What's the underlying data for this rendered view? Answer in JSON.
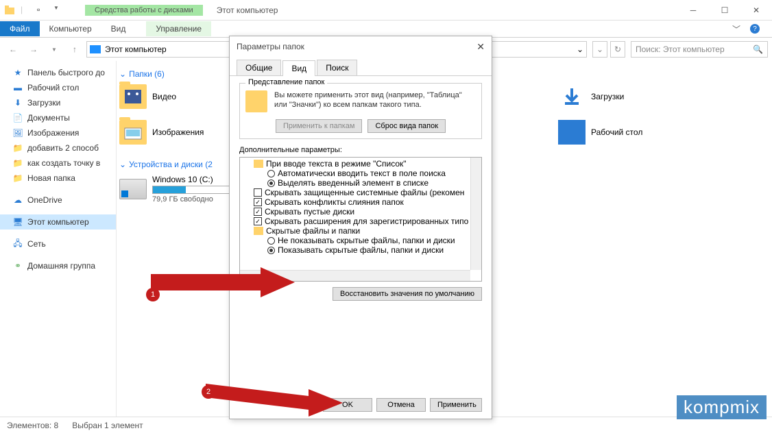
{
  "titlebar": {
    "contextual_tab": "Средства работы с дисками",
    "title": "Этот компьютер"
  },
  "ribbon": {
    "file": "Файл",
    "tabs": [
      "Компьютер",
      "Вид"
    ],
    "ctx_tab": "Управление"
  },
  "nav": {
    "location": "Этот компьютер",
    "search_placeholder": "Поиск: Этот компьютер"
  },
  "sidebar": {
    "quick": "Панель быстрого до",
    "items": [
      "Рабочий стол",
      "Загрузки",
      "Документы",
      "Изображения",
      "добавить 2 способ",
      "как создать точку в",
      "Новая папка"
    ],
    "onedrive": "OneDrive",
    "thispc": "Этот компьютер",
    "network": "Сеть",
    "homegroup": "Домашняя группа"
  },
  "content": {
    "folders_hdr": "Папки (6)",
    "folder_video": "Видео",
    "folder_images": "Изображения",
    "folder_downloads": "Загрузки",
    "folder_desktop": "Рабочий стол",
    "drives_hdr": "Устройства и диски (2",
    "drive_c": "Windows 10 (C:)",
    "drive_c_free": "79,9 ГБ свободно"
  },
  "dialog": {
    "title": "Параметры папок",
    "tabs": [
      "Общие",
      "Вид",
      "Поиск"
    ],
    "group_title": "Представление папок",
    "group_text": "Вы можете применить этот вид (например, \"Таблица\" или \"Значки\") ко всем папкам такого типа.",
    "btn_apply_folders": "Применить к папкам",
    "btn_reset_folders": "Сброс вида папок",
    "adv_label": "Дополнительные параметры:",
    "tree": {
      "n0": "При вводе текста в режиме \"Список\"",
      "n0a": "Автоматически вводить текст в поле поиска",
      "n0b": "Выделять введенный элемент в списке",
      "n1": "Скрывать защищенные системные файлы (рекомен",
      "n2": "Скрывать конфликты слияния папок",
      "n3": "Скрывать пустые диски",
      "n4": "Скрывать расширения для зарегистрированных типо",
      "n5": "Скрытые файлы и папки",
      "n5a": "Не показывать скрытые файлы, папки и диски",
      "n5b": "Показывать скрытые файлы, папки и диски"
    },
    "btn_restore": "Восстановить значения по умолчанию",
    "btn_ok": "OK",
    "btn_cancel": "Отмена",
    "btn_apply": "Применить"
  },
  "status": {
    "count": "Элементов: 8",
    "selected": "Выбран 1 элемент"
  },
  "annot": {
    "b1": "1",
    "b2": "2"
  },
  "watermark": "kompmix"
}
